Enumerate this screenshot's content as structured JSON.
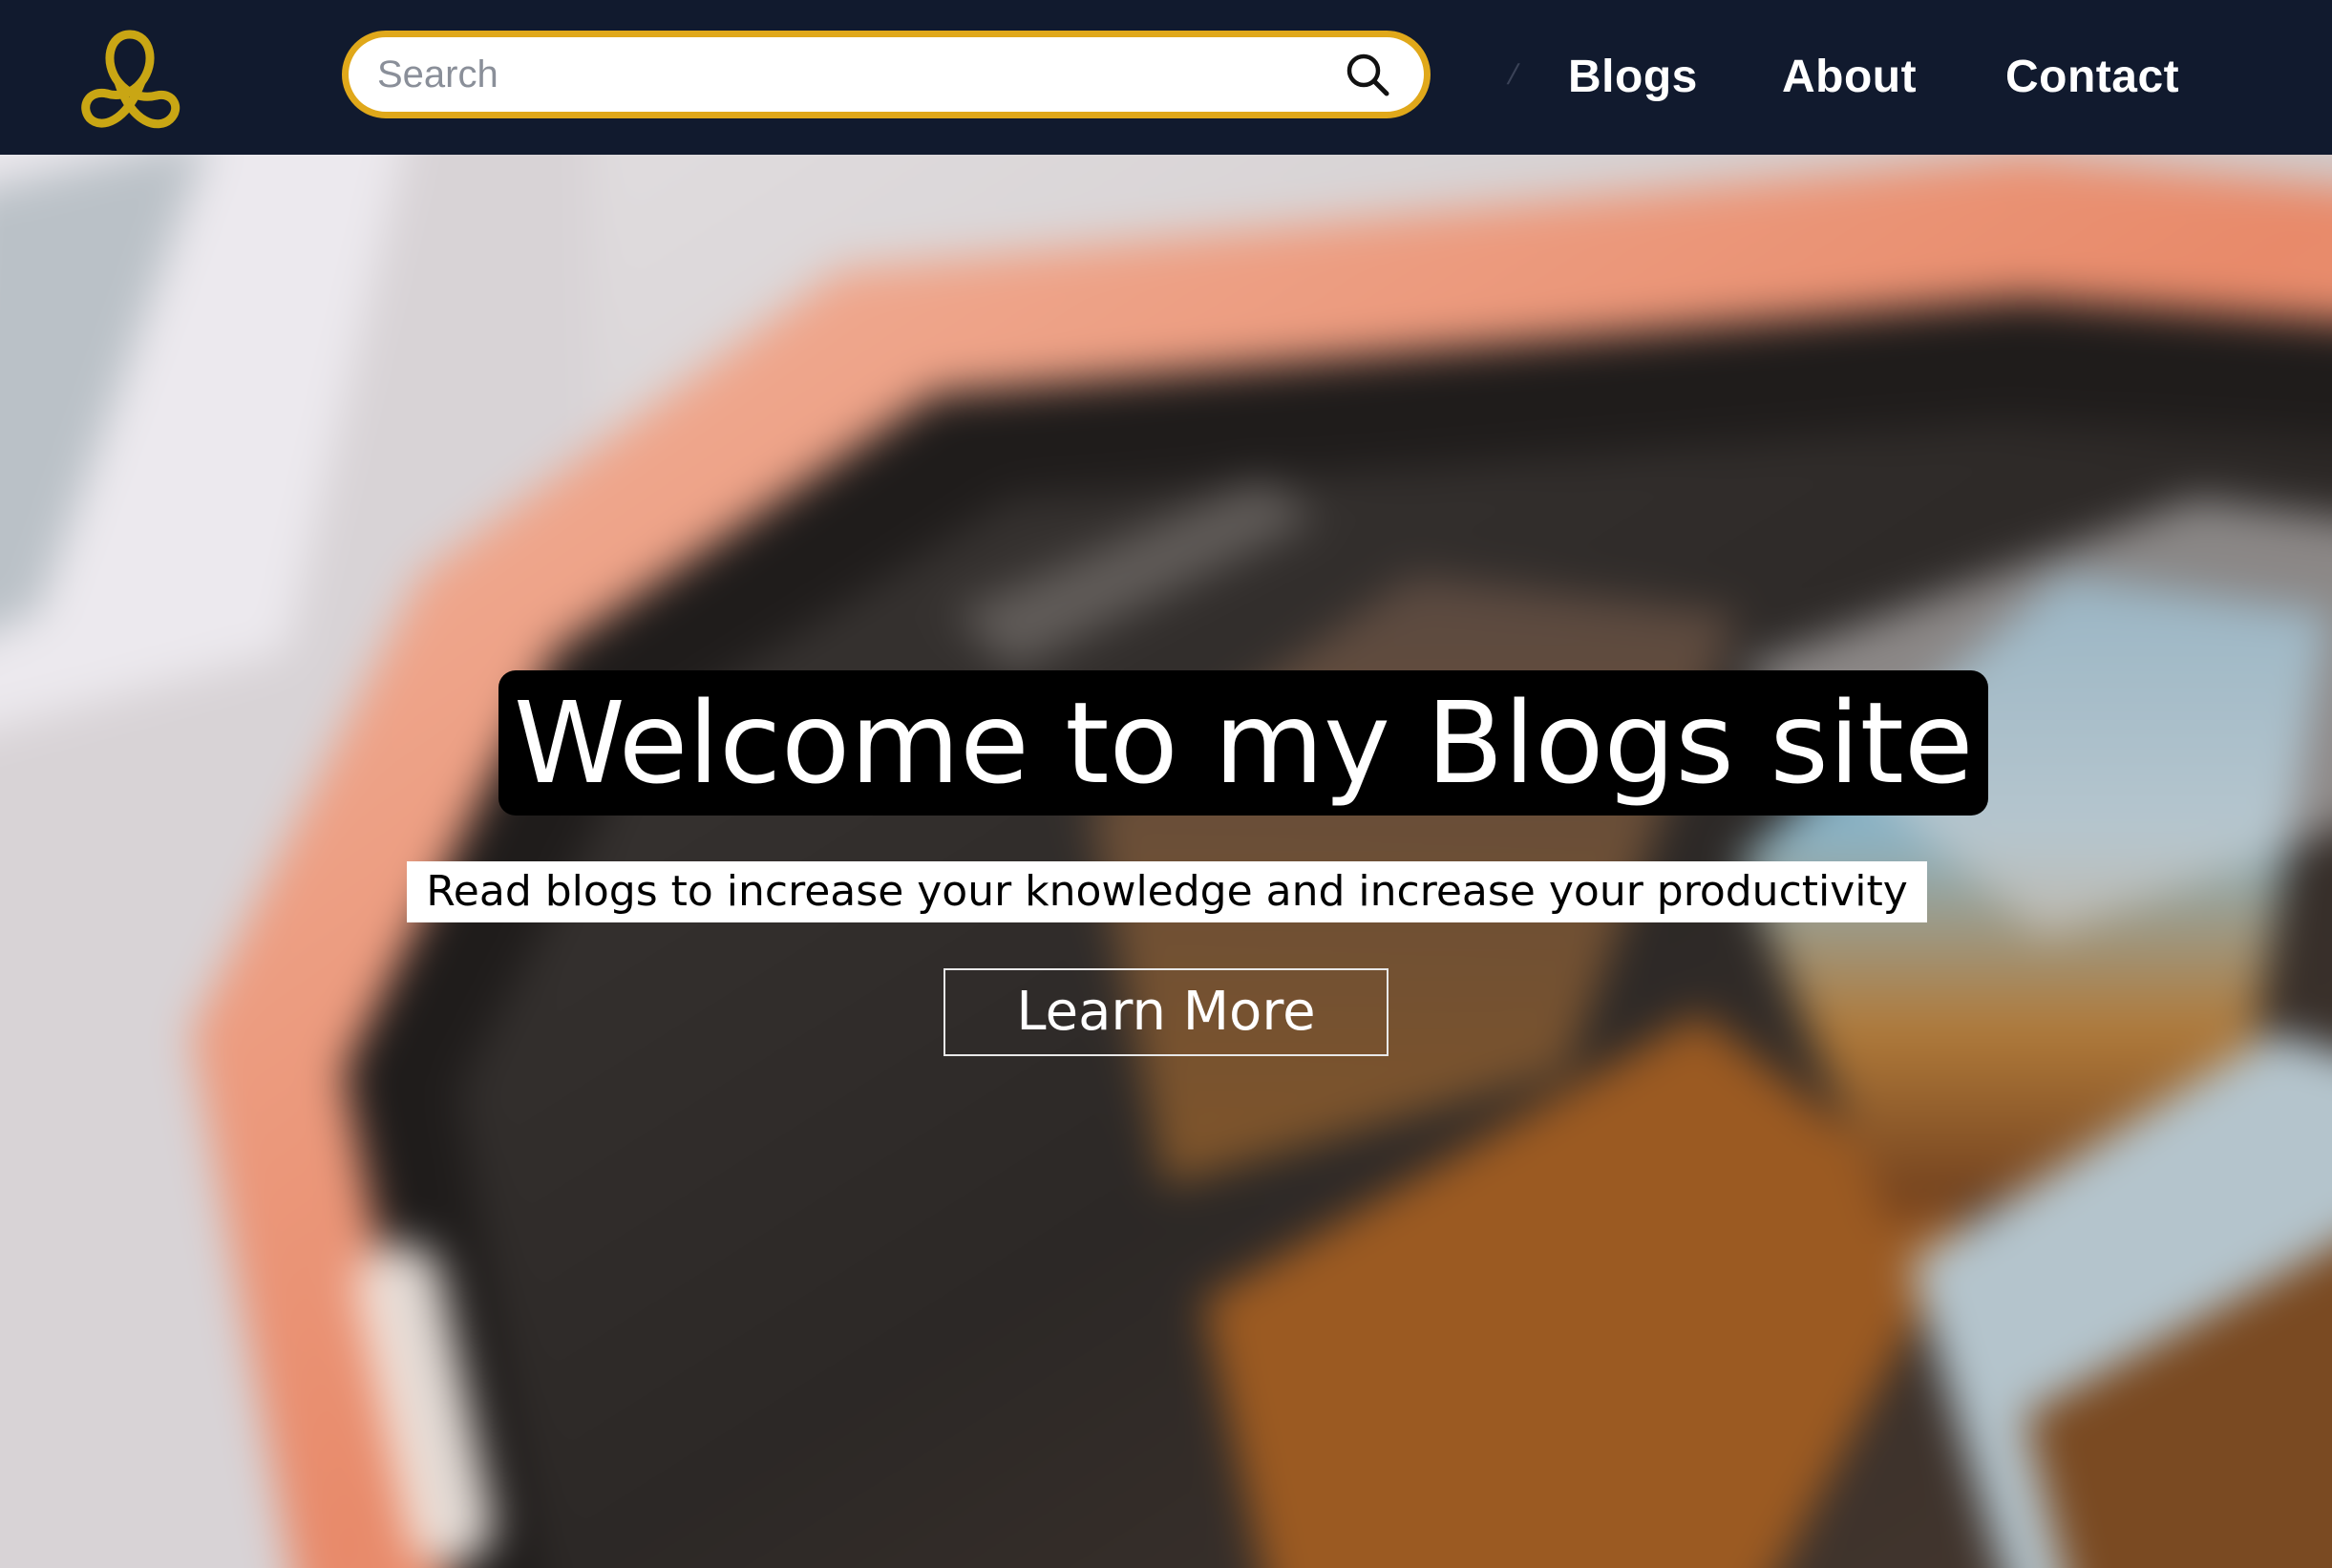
{
  "navbar": {
    "search": {
      "placeholder": "Search",
      "value": ""
    },
    "separator": "/",
    "links": [
      {
        "label": "Blogs"
      },
      {
        "label": "About"
      },
      {
        "label": "Contact"
      }
    ]
  },
  "hero": {
    "title": "Welcome to my Blogs site",
    "subtitle": "Read blogs to increase your knowledge and increase your productivity",
    "cta_label": "Learn More"
  },
  "icons": {
    "logo": "interlocking-rings-logo",
    "search": "search-icon"
  },
  "colors": {
    "navbar_bg": "#111a2e",
    "accent": "#e0a81a",
    "logo": "#c9a614",
    "title_bg": "#000000",
    "subtitle_bg": "#ffffff"
  }
}
